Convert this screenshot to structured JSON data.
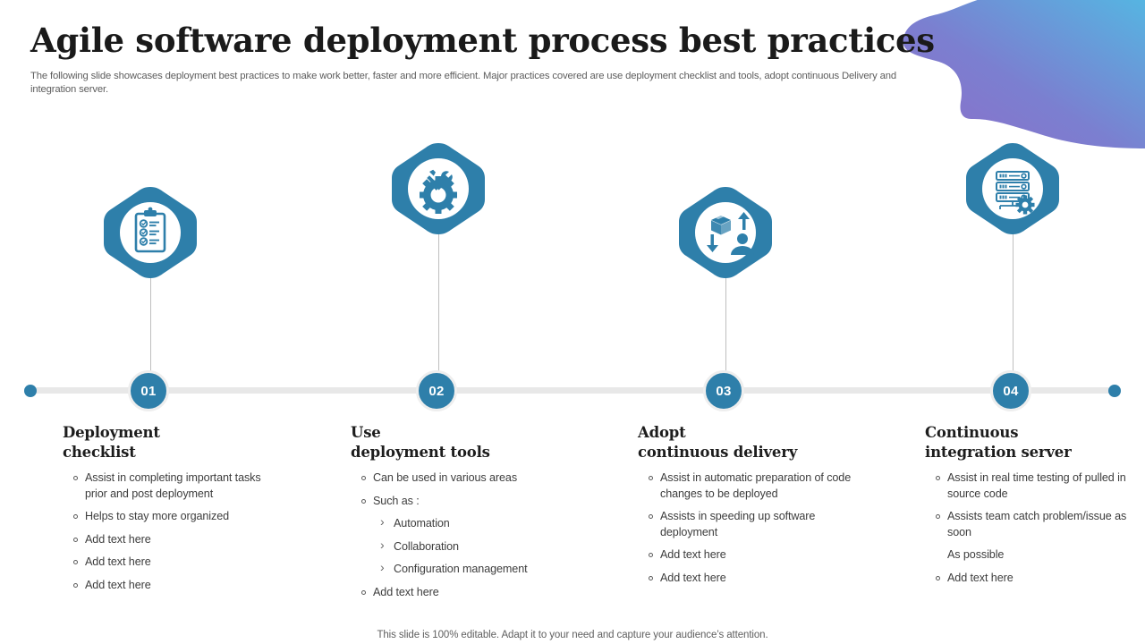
{
  "header": {
    "title": "Agile software deployment process best practices",
    "subtitle": "The following slide showcases deployment best practices to make work better, faster and more efficient. Major practices covered are use deployment checklist and tools, adopt continuous Delivery and integration server."
  },
  "colors": {
    "accent_blue": "#2e7faa",
    "axis_gray": "#e8e8e8",
    "blob_purple": "#8a6fc8",
    "blob_blue": "#5bb4df",
    "heading_text": "#1d1d1d",
    "body_text": "#3d3d3d"
  },
  "timeline": {
    "left_cap": "end-dot",
    "right_cap": "end-dot"
  },
  "columns": [
    {
      "number": "01",
      "icon": "clipboard-checklist-icon",
      "icon_position": "low",
      "heading_line1": "Deployment",
      "heading_line2": "checklist",
      "bullets": [
        {
          "level": 1,
          "text": "Assist in completing important tasks prior and post deployment"
        },
        {
          "level": 1,
          "text": "Helps to stay more organized"
        },
        {
          "level": 1,
          "text": "Add text here"
        },
        {
          "level": 1,
          "text": "Add text here"
        },
        {
          "level": 1,
          "text": "Add text here"
        }
      ]
    },
    {
      "number": "02",
      "icon": "gear-tools-icon",
      "icon_position": "high",
      "heading_line1": "Use",
      "heading_line2": "deployment tools",
      "bullets": [
        {
          "level": 1,
          "text": "Can be used in various areas"
        },
        {
          "level": 1,
          "text": "Such as :"
        },
        {
          "level": 2,
          "text": "Automation"
        },
        {
          "level": 2,
          "text": "Collaboration"
        },
        {
          "level": 2,
          "text": "Configuration management"
        },
        {
          "level": 1,
          "text": "Add text here"
        }
      ]
    },
    {
      "number": "03",
      "icon": "package-delivery-person-icon",
      "icon_position": "low",
      "heading_line1": "Adopt",
      "heading_line2": "continuous delivery",
      "bullets": [
        {
          "level": 1,
          "text": "Assist in automatic preparation of code changes to be deployed"
        },
        {
          "level": 1,
          "text": "Assists in speeding up software deployment"
        },
        {
          "level": 1,
          "text": "Add text here"
        },
        {
          "level": 1,
          "text": "Add text here"
        }
      ]
    },
    {
      "number": "04",
      "icon": "server-rack-gear-icon",
      "icon_position": "high",
      "heading_line1": "Continuous",
      "heading_line2": "integration server",
      "bullets": [
        {
          "level": 1,
          "text": "Assist in real time testing of pulled in source code"
        },
        {
          "level": 1,
          "text": "Assists team catch problem/issue as soon"
        },
        {
          "level": 0,
          "text": "As possible"
        },
        {
          "level": 1,
          "text": "Add text here"
        }
      ]
    }
  ],
  "footer": {
    "note": "This slide is 100% editable. Adapt it to your need and capture your audience’s attention."
  }
}
